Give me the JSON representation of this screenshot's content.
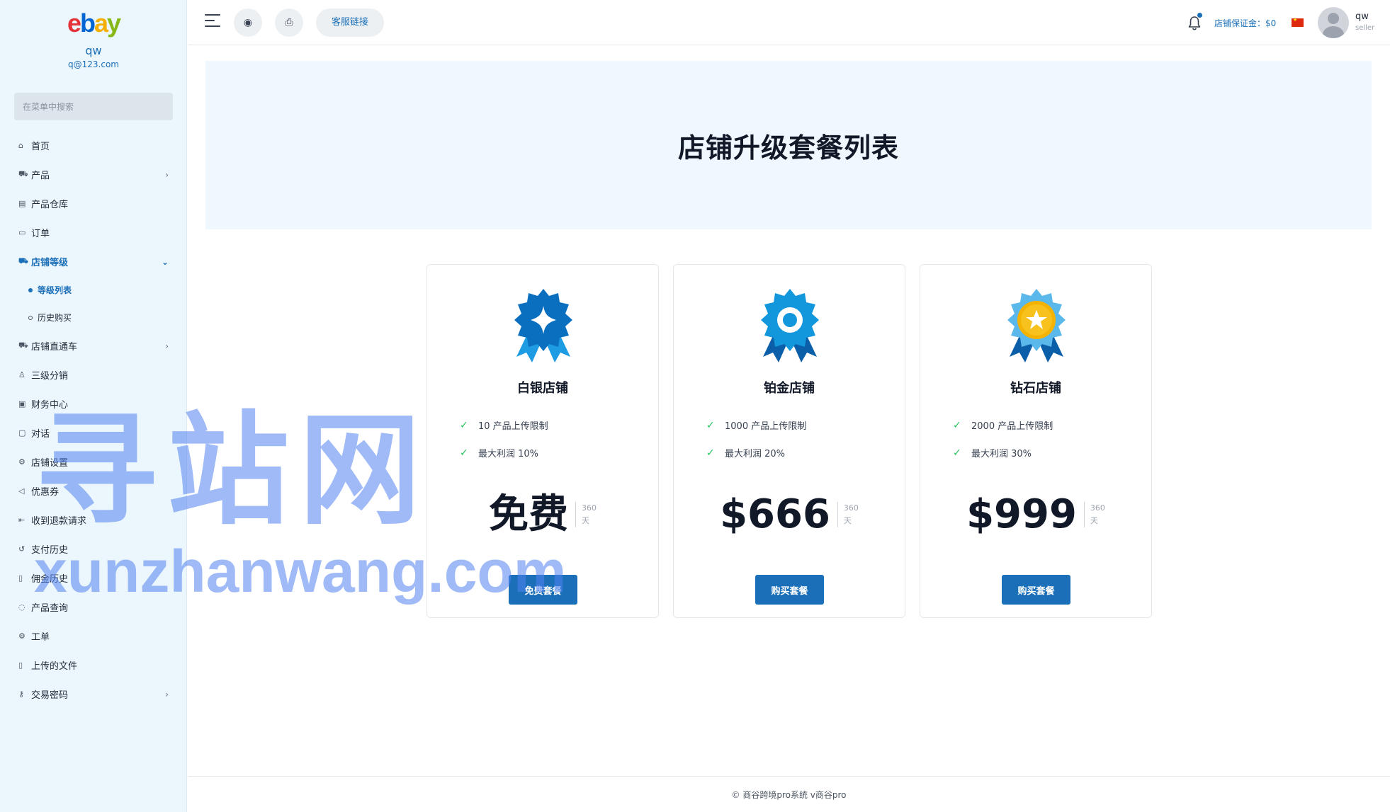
{
  "brand": {
    "logo_e": "e",
    "logo_b": "b",
    "logo_a": "a",
    "logo_y": "y"
  },
  "user": {
    "name": "qw",
    "email": "q@123.com"
  },
  "search": {
    "placeholder": "在菜单中搜索"
  },
  "sidebar": {
    "items": [
      {
        "label": "首页",
        "icon": "home-icon"
      },
      {
        "label": "产品",
        "icon": "cart-icon"
      },
      {
        "label": "产品仓库",
        "icon": "warehouse-icon"
      },
      {
        "label": "订单",
        "icon": "order-icon"
      },
      {
        "label": "店铺等级",
        "icon": "cart-icon"
      },
      {
        "label": "店铺直通车",
        "icon": "cart-icon"
      },
      {
        "label": "三级分销",
        "icon": "user-icon"
      },
      {
        "label": "财务中心",
        "icon": "wallet-icon"
      },
      {
        "label": "对话",
        "icon": "chat-icon"
      },
      {
        "label": "店铺设置",
        "icon": "gear-icon"
      },
      {
        "label": "优惠券",
        "icon": "megaphone-icon"
      },
      {
        "label": "收到退款请求",
        "icon": "refund-icon"
      },
      {
        "label": "支付历史",
        "icon": "history-icon"
      },
      {
        "label": "佣金历史",
        "icon": "file-icon"
      },
      {
        "label": "产品查询",
        "icon": "help-icon"
      },
      {
        "label": "工单",
        "icon": "gear-icon"
      },
      {
        "label": "上传的文件",
        "icon": "upload-file-icon"
      },
      {
        "label": "交易密码",
        "icon": "key-icon"
      }
    ],
    "sub_items": [
      {
        "label": "等级列表"
      },
      {
        "label": "历史购买"
      }
    ]
  },
  "topbar": {
    "service_label": "客服链接",
    "deposit_label": "店铺保证金：$0",
    "account_name": "qw",
    "account_role": "seller"
  },
  "hero": {
    "title": "店铺升级套餐列表"
  },
  "plans": [
    {
      "name": "白银店铺",
      "feature1": "10 产品上传限制",
      "feature2": "最大利润 10%",
      "price": "免费",
      "period_num": "360",
      "period_unit": "天",
      "button": "免费套餐",
      "badge_color": "#0b6fc0",
      "badge_accent": "#1d9be3"
    },
    {
      "name": "铂金店铺",
      "feature1": "1000 产品上传限制",
      "feature2": "最大利润 20%",
      "price": "$666",
      "period_num": "360",
      "period_unit": "天",
      "button": "购买套餐",
      "badge_color": "#1296dc",
      "badge_accent": "#0b5ea8"
    },
    {
      "name": "钻石店铺",
      "feature1": "2000 产品上传限制",
      "feature2": "最大利润 30%",
      "price": "$999",
      "period_num": "360",
      "period_unit": "天",
      "button": "购买套餐",
      "badge_color": "#f5b301",
      "badge_accent": "#5bb8ea"
    }
  ],
  "footer": {
    "text": "© 商谷跨境pro系统 v商谷pro"
  },
  "watermark": {
    "title": "寻站网",
    "domain": "xunzhanwang.com"
  },
  "colors": {
    "accent": "#1a6fb8",
    "sidebar_bg": "#ecf6fd",
    "hero_bg": "#eff8fe",
    "check": "#22c55e"
  }
}
